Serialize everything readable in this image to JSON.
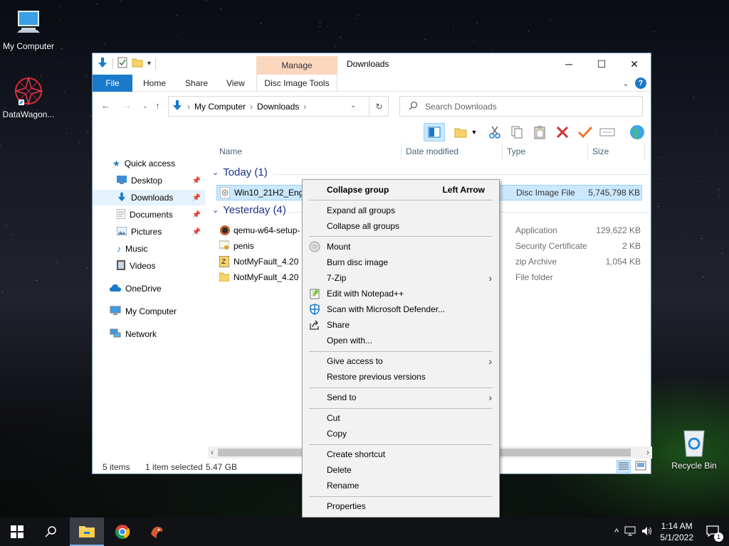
{
  "desktop": {
    "icons": [
      {
        "label": "My Computer"
      },
      {
        "label": "DataWagon..."
      },
      {
        "label": "Recycle Bin"
      }
    ]
  },
  "window": {
    "title": "Downloads",
    "manage_tab": "Manage",
    "ribbon_tabs": [
      "File",
      "Home",
      "Share",
      "View",
      "Disc Image Tools"
    ],
    "address": {
      "segments": [
        "My Computer",
        "Downloads"
      ]
    },
    "search_placeholder": "Search Downloads",
    "nav": {
      "quick_access": "Quick access",
      "items": [
        "Desktop",
        "Downloads",
        "Documents",
        "Pictures",
        "Music",
        "Videos"
      ],
      "onedrive": "OneDrive",
      "my_computer": "My Computer",
      "network": "Network"
    },
    "columns": [
      "Name",
      "Date modified",
      "Type",
      "Size"
    ],
    "groups": [
      {
        "label": "Today (1)",
        "files": [
          {
            "name": "Win10_21H2_Engli",
            "type": "Disc Image File",
            "size": "5,745,798 KB"
          }
        ]
      },
      {
        "label": "Yesterday (4)",
        "files": [
          {
            "name": "qemu-w64-setup-",
            "type": "Application",
            "size": "129,622 KB"
          },
          {
            "name": "penis",
            "type": "Security Certificate",
            "size": "2 KB"
          },
          {
            "name": "NotMyFault_4.20",
            "type": "zip Archive",
            "size": "1,054 KB"
          },
          {
            "name": "NotMyFault_4.20",
            "type": "File folder",
            "size": ""
          }
        ]
      }
    ],
    "status": {
      "items": "5 items",
      "selected": "1 item selected",
      "size": "5.47 GB"
    }
  },
  "context_menu": {
    "header": {
      "label": "Collapse group",
      "shortcut": "Left Arrow"
    },
    "items": [
      "Expand all groups",
      "Collapse all groups",
      "Mount",
      "Burn disc image",
      "7-Zip",
      "Edit with Notepad++",
      "Scan with Microsoft Defender...",
      "Share",
      "Open with...",
      "Give access to",
      "Restore previous versions",
      "Send to",
      "Cut",
      "Copy",
      "Create shortcut",
      "Delete",
      "Rename",
      "Properties"
    ]
  },
  "taskbar": {
    "time": "1:14 AM",
    "date": "5/1/2022",
    "notification_count": "1"
  },
  "colors": {
    "accent": "#1979ca",
    "manage_tab": "#fbd7be",
    "selection": "#cce8ff"
  }
}
